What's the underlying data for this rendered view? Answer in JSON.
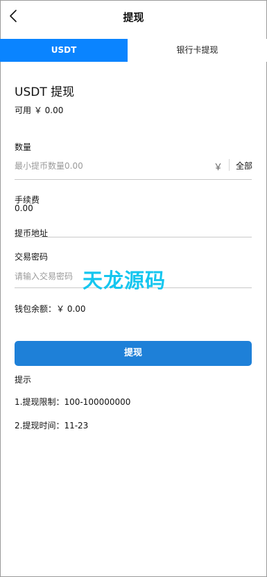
{
  "header": {
    "title": "提现",
    "back_icon": "chevron-left-icon"
  },
  "tabs": [
    {
      "label": "USDT",
      "active": true
    },
    {
      "label": "银行卡提现",
      "active": false
    }
  ],
  "section": {
    "title": "USDT 提现",
    "available": "可用 ￥ 0.00"
  },
  "amount": {
    "label": "数量",
    "placeholder": "最小提币数量0.00",
    "currency_symbol": "￥",
    "all_label": "全部"
  },
  "fee": {
    "label": "手续费",
    "value": "0.00"
  },
  "address": {
    "label": "提币地址"
  },
  "password": {
    "label": "交易密码",
    "placeholder": "请输入交易密码"
  },
  "wallet": {
    "balance_text": "钱包余额：￥ 0.00"
  },
  "submit": {
    "label": "提现"
  },
  "tips": {
    "title": "提示",
    "items": [
      "1.提现限制：100-100000000",
      "2.提现时间：11-23"
    ]
  },
  "watermark": {
    "text": "天龙源码"
  },
  "colors": {
    "accent": "#0a84ff",
    "button": "#1e80d8",
    "watermark": "#15c6ef"
  }
}
